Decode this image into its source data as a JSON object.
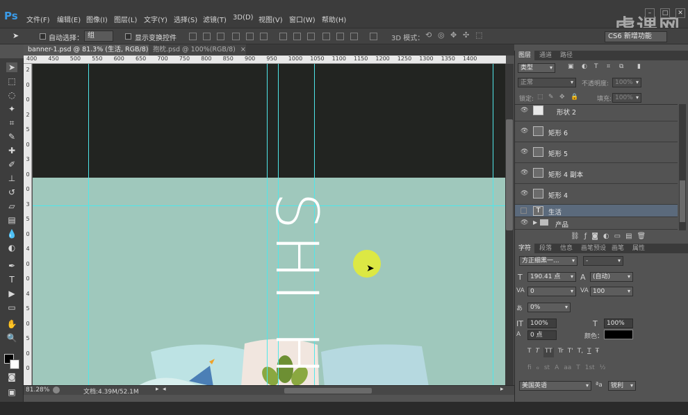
{
  "app": {
    "logo": "Ps",
    "brand": "虎课网"
  },
  "menu": [
    "文件(F)",
    "编辑(E)",
    "图像(I)",
    "图层(L)",
    "文字(Y)",
    "选择(S)",
    "滤镜(T)",
    "3D(D)",
    "视图(V)",
    "窗口(W)",
    "帮助(H)"
  ],
  "window_controls": [
    "–",
    "□",
    "✕"
  ],
  "options": {
    "auto_select_label": "自动选择：",
    "auto_select_value": "组",
    "show_transform_label": "显示变换控件",
    "mode_3d_label": "3D 模式：",
    "workspace": "CS6 新增功能"
  },
  "tabs": [
    {
      "label": "banner-1.psd @ 81.3% (生活, RGB/8)",
      "close": "×"
    },
    {
      "label": "抱枕.psd @ 100%(RGB/8)",
      "close": "×"
    }
  ],
  "ruler": {
    "top": [
      "400",
      "450",
      "500",
      "550",
      "600",
      "650",
      "700",
      "750",
      "800",
      "850",
      "900",
      "950",
      "1000",
      "1050",
      "1100",
      "1150",
      "1200",
      "1250",
      "1300",
      "1350",
      "1400"
    ],
    "left": [
      "2",
      "0",
      "0",
      "2",
      "5",
      "0",
      "3",
      "0",
      "0",
      "3",
      "5",
      "0",
      "4",
      "0",
      "0",
      "4",
      "5",
      "0",
      "5",
      "0",
      "0"
    ]
  },
  "canvas": {
    "text": "SHI HU"
  },
  "status": {
    "zoom": "81.28%",
    "doc": "文档:4.39M/52.1M"
  },
  "layers_panel": {
    "tabs": [
      "图层",
      "通道",
      "路径"
    ],
    "filter_label": "类型",
    "blend_mode": "正常",
    "opacity_label": "不透明度:",
    "opacity_value": "100%",
    "lock_label": "锁定:",
    "fill_label": "填充:",
    "fill_value": "100%",
    "layers": [
      {
        "name": "形状 2",
        "visible": true,
        "type": "shape"
      },
      {
        "name": "矩形 6",
        "visible": true,
        "type": "shape"
      },
      {
        "name": "矩形 5",
        "visible": true,
        "type": "shape"
      },
      {
        "name": "矩形 4 副本",
        "visible": true,
        "type": "shape"
      },
      {
        "name": "矩形 4",
        "visible": true,
        "type": "shape"
      },
      {
        "name": "生活",
        "visible": false,
        "type": "text",
        "selected": true
      },
      {
        "name": "产品",
        "visible": true,
        "type": "group"
      }
    ]
  },
  "char_panel": {
    "tabs": [
      "字符",
      "段落",
      "信息",
      "画笔预设",
      "画笔",
      "属性"
    ],
    "font_family": "方正细黑一...",
    "font_style": "-",
    "size": "190.41 点",
    "leading": "(自动)",
    "kerning": "0",
    "tracking": "100",
    "scale_v": "0%",
    "scale_h1": "100%",
    "scale_h2": "100%",
    "baseline": "0 点",
    "color_label": "颜色：",
    "styles": [
      "T",
      "T",
      "TT",
      "Tr",
      "T'",
      "T,",
      "T",
      "Ŧ"
    ],
    "opentype": [
      "fi",
      "ℴ",
      "st",
      "A",
      "aa",
      "T",
      "1st",
      "½"
    ],
    "language": "美国英语",
    "aa_label": "ªa",
    "antialias": "锐利"
  },
  "colors": {
    "accent_blue": "#3a9be8",
    "guide": "#4fe7ea",
    "canvas_dark": "#222421",
    "canvas_light": "#9fc8bc",
    "cursor": "#e2eb36"
  }
}
